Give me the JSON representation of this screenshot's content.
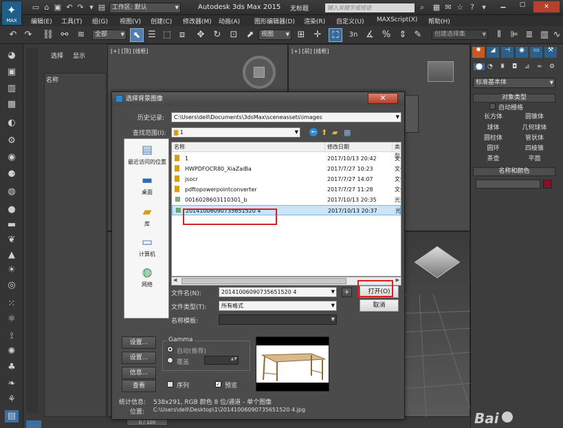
{
  "window": {
    "app_logo_text": "MAX",
    "workspace_label": "工作区: 默认",
    "title": "Autodesk 3ds Max  2015",
    "doc_name": "无标题",
    "search_placeholder": "键入关键字或短语"
  },
  "menu": [
    "编辑(E)",
    "工具(T)",
    "组(G)",
    "视图(V)",
    "创建(C)",
    "修改器(M)",
    "动画(A)",
    "图形编辑器(D)",
    "渲染(R)",
    "自定义(U)",
    "MAXScript(X)",
    "帮助(H)"
  ],
  "toolbar": {
    "filter_combo": "全部",
    "ref_coord_combo": "视图",
    "snap_label": "3n",
    "named_selection_placeholder": "创建选择集"
  },
  "explorer": {
    "tabs": [
      "选择",
      "显示"
    ],
    "column_header": "名称"
  },
  "viewports": {
    "top_label": "[+] [顶] [线框]",
    "front_label": "[+] [前] [线框]"
  },
  "statusbar": {
    "frame_counter": "0 / 100"
  },
  "command_panel": {
    "category_combo": "标准基本体",
    "object_type_title": "对象类型",
    "autogrid_label": "自动栅格",
    "buttons": [
      "长方体",
      "圆锥体",
      "球体",
      "几何球体",
      "圆柱体",
      "管状体",
      "圆环",
      "四棱锥",
      "茶壶",
      "平面"
    ],
    "name_color_title": "名称和颜色",
    "object_color": "#8b0e28"
  },
  "dialog": {
    "title": "选择背景图像",
    "history_label": "历史记录:",
    "history_value": "C:\\Users\\dell\\Documents\\3dsMax\\sceneassets\\images",
    "lookin_label": "查找范围(I):",
    "lookin_value": "1",
    "places": [
      "最近访问的位置",
      "桌面",
      "库",
      "计算机",
      "网络"
    ],
    "columns": {
      "name": "名称",
      "date": "修改日期",
      "type": "类型"
    },
    "files": [
      {
        "name": "1",
        "date": "2017/10/13 20:42",
        "type": "文件",
        "kind": "folder"
      },
      {
        "name": "HWPDFOCR80_XiaZaiBa",
        "date": "2017/7/27 10:23",
        "type": "文件",
        "kind": "folder"
      },
      {
        "name": "jsocr",
        "date": "2017/7/27 14:07",
        "type": "文件",
        "kind": "folder"
      },
      {
        "name": "pdftopowerpointconverter",
        "date": "2017/7/27 11:28",
        "type": "文件",
        "kind": "folder"
      },
      {
        "name": "0016028603110301_b",
        "date": "2017/10/13 20:35",
        "type": "光影",
        "kind": "image"
      },
      {
        "name": "20141006090735651520 4",
        "date": "2017/10/13 20:37",
        "type": "光影",
        "kind": "image"
      }
    ],
    "selected_file_index": 5,
    "filename_label": "文件名(N):",
    "filename_value": "20141006090735651520 4",
    "filetype_label": "文件类型(T):",
    "filetype_value": "所有格式",
    "nametemplate_label": "名称模板:",
    "open_button": "打开(O)",
    "cancel_button": "取消",
    "plus_button": "+",
    "setup_button": "设置...",
    "setup_button2": "设置...",
    "info_button": "信息...",
    "view_button": "查看",
    "gamma_title": "Gamma",
    "gamma_auto": "自动(推荐)",
    "gamma_override": "覆盖",
    "sequence_label": "序列",
    "preview_label": "预览",
    "stats_label": "统计信息:",
    "stats_value": "538x291, RGB 颜色 8 位/通道 - 单个图像",
    "location_label": "位置:",
    "location_value": "C:\\Users\\dell\\Desktop\\1\\20141006090735651520 4.jpg"
  },
  "watermark": "Bai"
}
